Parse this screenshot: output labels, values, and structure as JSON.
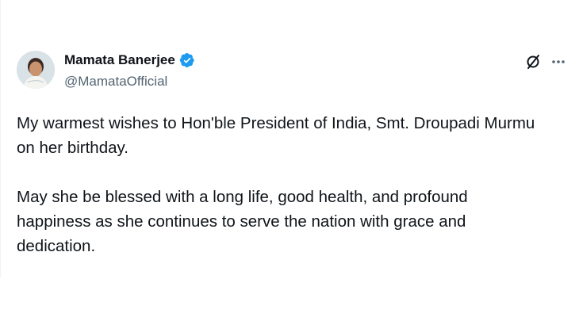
{
  "author": {
    "display_name": "Mamata Banerjee",
    "handle": "@MamataOfficial",
    "verified": true
  },
  "icons": {
    "avatar": "profile-photo",
    "verified": "verified-badge-icon",
    "grok": "grok-icon",
    "more": "more-options-icon"
  },
  "colors": {
    "verified_badge": "#1d9bf0",
    "text_primary": "#0f1419",
    "text_secondary": "#536471"
  },
  "tweet": {
    "paragraph_1": "My warmest wishes to Hon'ble President of India, Smt. Droupadi Murmu\non her birthday.",
    "paragraph_2": "May she be blessed with a long life, good health, and profound\nhappiness as she continues to serve the nation with grace and\ndedication."
  }
}
